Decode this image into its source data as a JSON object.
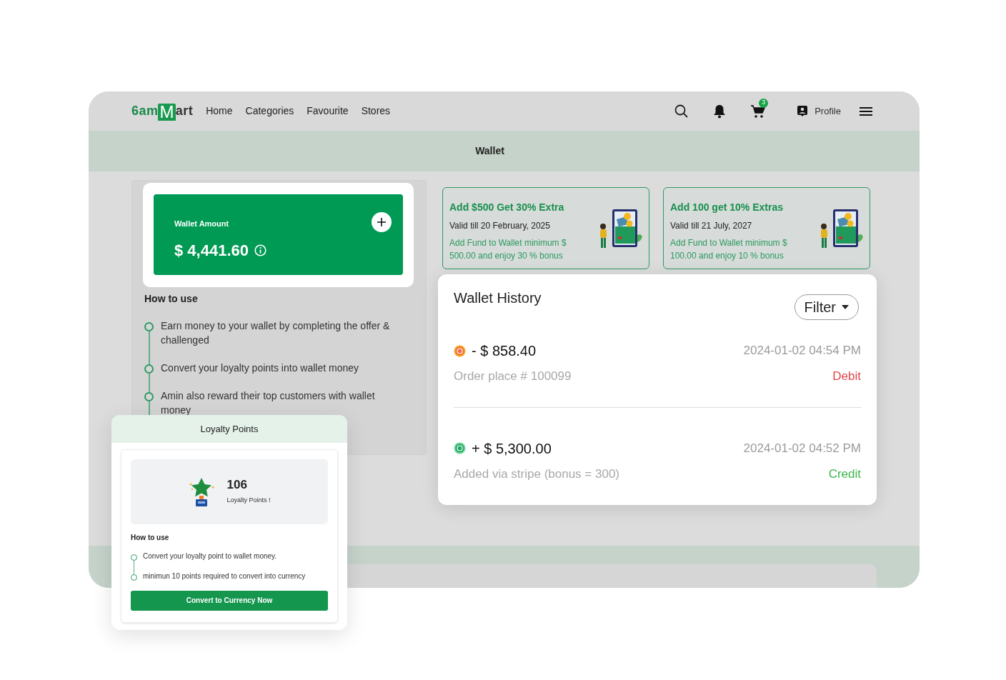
{
  "logo": {
    "parts": [
      {
        "text": "6am",
        "kind": "green"
      },
      {
        "text": "M",
        "kind": "bag"
      },
      {
        "text": "art",
        "kind": "dark"
      }
    ]
  },
  "nav": [
    "Home",
    "Categories",
    "Favourite",
    "Stores"
  ],
  "header": {
    "cart_count": "3",
    "profile": "Profile"
  },
  "page_title": "Wallet",
  "wallet": {
    "label": "Wallet Amount",
    "amount": "$ 4,441.60"
  },
  "how_to_use": {
    "title": "How to use",
    "steps": [
      "Earn money to your wallet by completing the offer & challenged",
      "Convert your loyalty points into wallet money",
      "Amin also reward their top customers with wallet money"
    ]
  },
  "offers": [
    {
      "title": "Add $500 Get 30% Extra",
      "valid": "Valid till 20 February, 2025",
      "description": "Add Fund to Wallet minimum $ 500.00 and enjoy 30 % bonus"
    },
    {
      "title": "Add 100 get 10% Extras",
      "valid": "Valid till 21 July, 2027",
      "description": "Add Fund to Wallet minimum $ 100.00 and enjoy 10 % bonus"
    }
  ],
  "history": {
    "title": "Wallet History",
    "filter": "Filter",
    "items": [
      {
        "kind": "debit",
        "amount": "- $ 858.40",
        "date": "2024-01-02 04:54 PM",
        "note": "Order place # 100099",
        "label": "Debit"
      },
      {
        "kind": "credit",
        "amount": "+ $ 5,300.00",
        "date": "2024-01-02 04:52 PM",
        "note": "Added via stripe (bonus = 300)",
        "label": "Credit"
      }
    ]
  },
  "loyalty": {
    "title": "Loyalty Points",
    "points": "106",
    "points_label": "Loyalty Points !",
    "how_title": "How to use",
    "steps": [
      "Convert your loyalty point to wallet money.",
      "minimun 10 points required to convert into currency"
    ],
    "button": "Convert to Currency Now"
  }
}
